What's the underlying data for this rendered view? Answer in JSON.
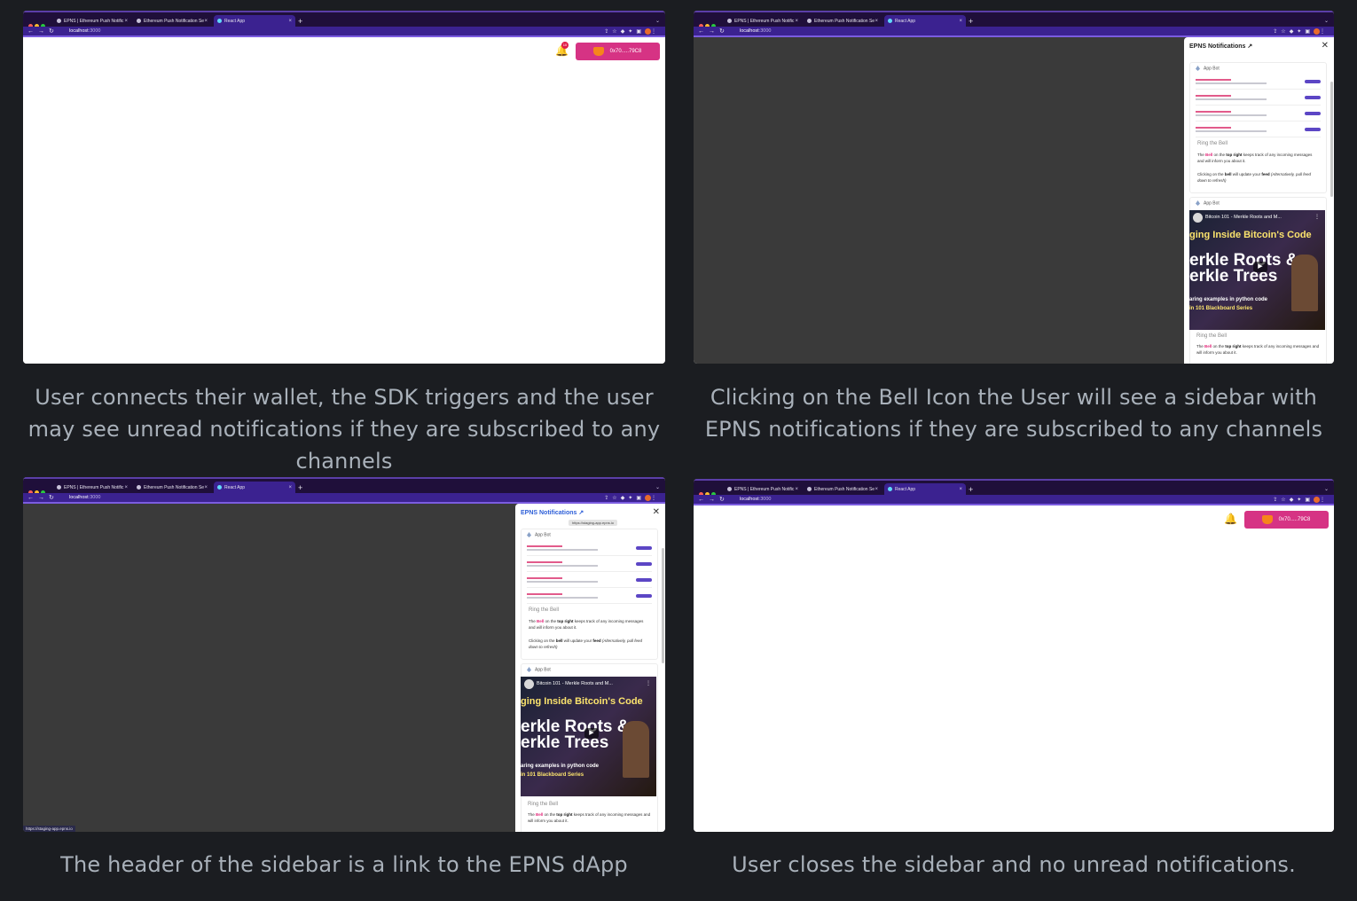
{
  "captions": {
    "p1": "User connects their wallet, the SDK triggers and the user may see unread notifications if they are subscribed to any channels",
    "p2": "Clicking on the Bell Icon the User will see a sidebar with EPNS notifications if they are subscribed to any channels",
    "p3": "The header of the sidebar is a link to the EPNS dApp",
    "p4": "User closes the sidebar and no unread notifications."
  },
  "browser": {
    "tabs": [
      "EPNS | Ethereum Push Notific",
      "Ethereum Push Notification Se",
      "React App"
    ],
    "new_tab": "+",
    "url_host": "localhost",
    "url_port": ":3000"
  },
  "app": {
    "wallet_label": "0x70.....79C8",
    "bell_badge": "10"
  },
  "sidebar": {
    "title": "EPNS Notifications",
    "link_glyph": "↗",
    "close_glyph": "✕",
    "tooltip": "https://staging-app.epns.io",
    "channel_name": "App Bot",
    "ring_title": "Ring the Bell",
    "ring_text_1a": "The ",
    "ring_bell": "Bell",
    "ring_text_1b": " on the ",
    "ring_top_right": "top right",
    "ring_text_1c": " keeps track of any incoming messages and will inform you about it.",
    "ring_text_2a": "Clicking on the ",
    "ring_bell_2": "bell",
    "ring_text_2b": " will update your ",
    "ring_feed": "feed",
    "ring_text_2c": " ",
    "ring_alt": "(Alternatively, pull feed down to refresh)",
    "video_title": "Bitcoin 101 - Merkle Roots and M...",
    "video_h1": "ging Inside Bitcoin's Code",
    "video_h2a": "erkle Roots &",
    "video_h2b": "erkle Trees",
    "video_h3": "aring examples in python code",
    "video_h4": "in 101 Blackboard Series"
  },
  "status_url": "https://staging-app.epns.io"
}
